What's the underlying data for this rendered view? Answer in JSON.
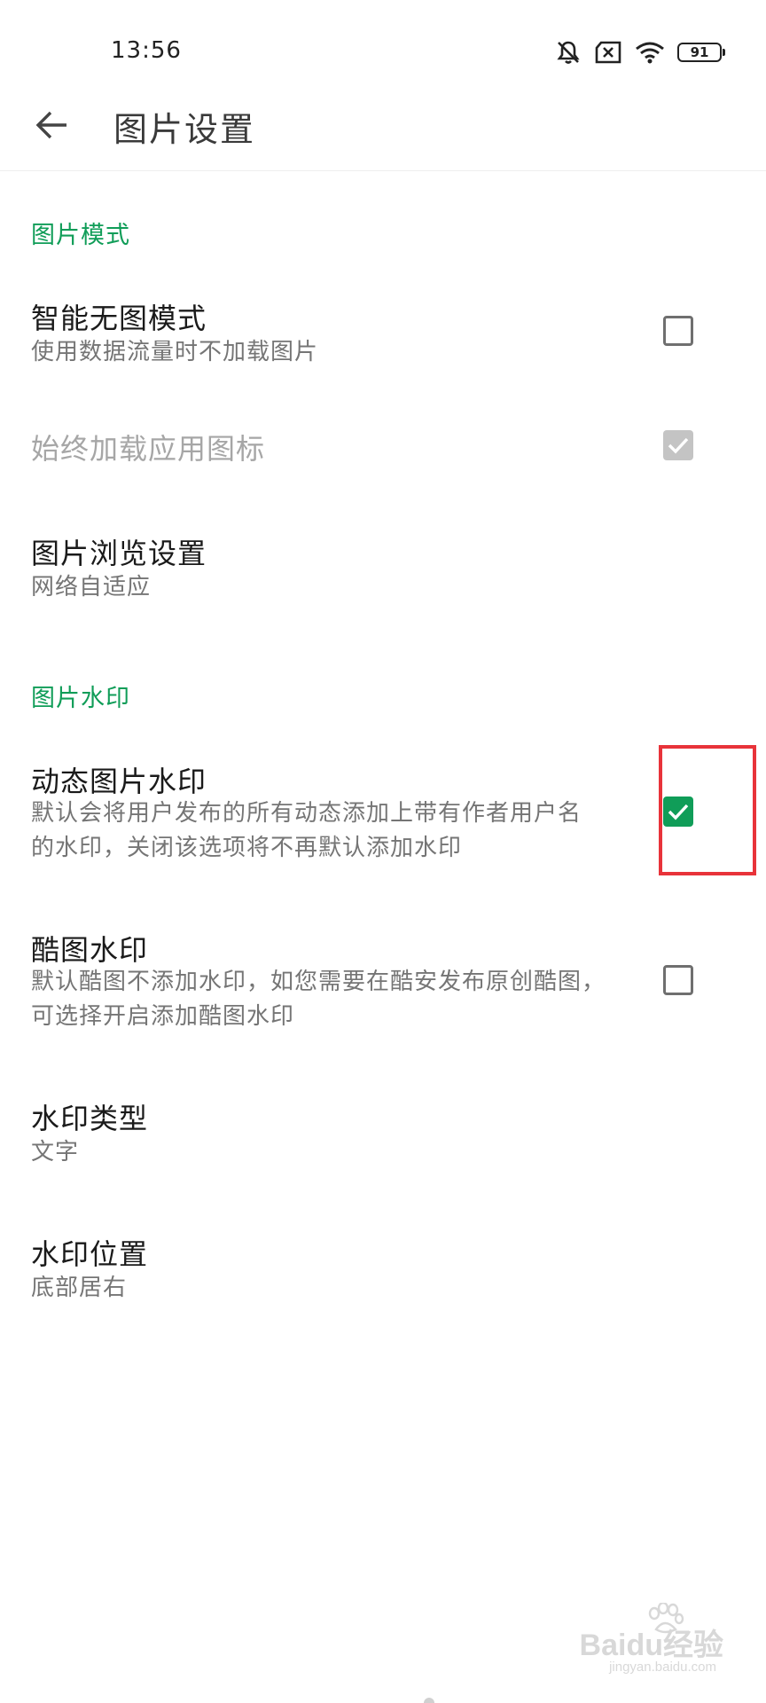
{
  "status_bar": {
    "time": "13:56",
    "battery": "91",
    "icons": [
      "bell-muted-icon",
      "no-sim-icon",
      "wifi-icon",
      "battery-icon"
    ]
  },
  "app_bar": {
    "back_icon": "arrow-left-icon",
    "title": "图片设置"
  },
  "sections": [
    {
      "header": "图片模式",
      "items": [
        {
          "title": "智能无图模式",
          "subtitle": "使用数据流量时不加载图片",
          "checkbox": "unchecked"
        },
        {
          "title": "始终加载应用图标",
          "subtitle": "",
          "checkbox": "checked-disabled"
        },
        {
          "title": "图片浏览设置",
          "subtitle": "网络自适应",
          "checkbox": "none"
        }
      ]
    },
    {
      "header": "图片水印",
      "items": [
        {
          "title": "动态图片水印",
          "subtitle_line1": "默认会将用户发布的所有动态添加上带有作者用户名",
          "subtitle_line2": "的水印，关闭该选项将不再默认添加水印",
          "checkbox": "checked"
        },
        {
          "title": "酷图水印",
          "subtitle_line1": "默认酷图不添加水印，如您需要在酷安发布原创酷图，",
          "subtitle_line2": "可选择开启添加酷图水印",
          "checkbox": "unchecked"
        },
        {
          "title": "水印类型",
          "subtitle": "文字",
          "checkbox": "none"
        },
        {
          "title": "水印位置",
          "subtitle": "底部居右",
          "checkbox": "none"
        }
      ]
    }
  ],
  "colors": {
    "accent": "#109d58",
    "highlight": "#e8333a",
    "disabled": "#c4c4c4"
  },
  "watermark": {
    "logo": "Baidu经验",
    "url": "jingyan.baidu.com"
  }
}
